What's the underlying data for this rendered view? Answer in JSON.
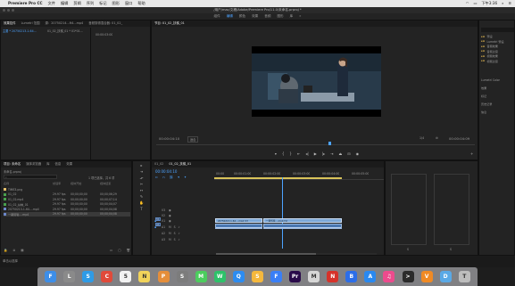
{
  "menubar": {
    "app_name": "Premiere Pro CC",
    "items": [
      "文件",
      "编辑",
      "剪辑",
      "序列",
      "标记",
      "图形",
      "窗口",
      "帮助"
    ],
    "clock": "下午3:36"
  },
  "titlebar": {
    "path": "/用户/mac/文稿/Adobe/Premiere Pro/11.0/未命名.prproj *"
  },
  "workspaces": [
    "组件",
    "编辑",
    "颜色",
    "效果",
    "音频",
    "图形",
    "库",
    "»"
  ],
  "source_panel": {
    "tabs": [
      "效果控件",
      "Lumetri 范围",
      "源：20750214...ft4...mp4",
      "音频剪辑混合器: 01_02_"
    ],
    "clip_label": "主要 * 20750213-1-64...",
    "sequence_label": "01_02_扶梯_01 * 01*01...",
    "timecode": "00:00:03:00"
  },
  "project_panel": {
    "tabs": [
      "项目: 未命名",
      "媒体浏览器",
      "库",
      "信息",
      "效果"
    ],
    "project_file": "未命名.prproj",
    "selection_info": "1 项已选择，共 6 项",
    "columns": [
      "名称",
      "帧速率",
      "媒体开始",
      "媒体结束"
    ],
    "items": [
      {
        "name": "TIME3.png",
        "fps": "",
        "start": "",
        "end": "",
        "color": "#e4c06a"
      },
      {
        "name": "01_02",
        "fps": "29.97 fps",
        "start": "00;00;00;00",
        "end": "00;00;06;29",
        "color": "#48a14d"
      },
      {
        "name": "01_02.mp4",
        "fps": "29.97 fps",
        "start": "00;00;00;00",
        "end": "00;00;07;14",
        "color": "#48a14d"
      },
      {
        "name": "01_02_扶梯_01",
        "fps": "29.97 fps",
        "start": "00;00;00;00",
        "end": "00;00;04;07",
        "color": "#48a14d"
      },
      {
        "name": "20750213-1-64....mp4",
        "fps": "29.97 fps",
        "start": "00;00;00;00",
        "end": "00;00;04;08",
        "color": "#6b86c8"
      },
      {
        "name": "一期剪辑....mp4",
        "fps": "29.97 fps",
        "start": "00;00;00;00",
        "end": "00;00;04;08",
        "color": "#6b86c8"
      }
    ]
  },
  "program_monitor": {
    "tab": "节目: 01_02_扶梯_01",
    "timecode": "00:00:04:10",
    "zoom": "适合",
    "resolution": "1/4",
    "duration": "00:00:04:09"
  },
  "timeline": {
    "tabs": [
      "01_02",
      "01_02_扶梯_01"
    ],
    "timecode": "00:00:04:10",
    "ruler": [
      "00:00",
      "00:00:01:00",
      "00:00:02:00",
      "00:00:03:00",
      "00:00:04:00",
      "00:00:05:00"
    ],
    "video_tracks": [
      "V3",
      "V2",
      "V1"
    ],
    "audio_tracks": [
      "A1",
      "A2",
      "A3"
    ],
    "clip_v1_a": "20750213-1-64....mp4 [V]",
    "clip_v1_b": "一期剪辑....mp4 [V]",
    "progress_fraction": 0.62
  },
  "effects_panel": {
    "folders": [
      "预设",
      "Lumetri 预设",
      "音频效果",
      "音频过渡",
      "视频效果",
      "视频过渡"
    ],
    "options": [
      "Lumetri Color",
      "效果",
      "标记",
      "历史记录",
      "信息"
    ]
  },
  "status_text": "单击以选择",
  "dock_apps": [
    {
      "name": "finder",
      "label": "F",
      "color": "#3d8ee8"
    },
    {
      "name": "launchpad",
      "label": "L",
      "color": "#8a8a8a"
    },
    {
      "name": "safari",
      "label": "S",
      "color": "#2f9be6"
    },
    {
      "name": "chrome",
      "label": "C",
      "color": "#e04a3a"
    },
    {
      "name": "calendar",
      "label": "5",
      "color": "#f2f2f2"
    },
    {
      "name": "notes",
      "label": "N",
      "color": "#f1d35a"
    },
    {
      "name": "photos",
      "label": "P",
      "color": "#e58e3a"
    },
    {
      "name": "system-prefs",
      "label": "S",
      "color": "#7c7c7c"
    },
    {
      "name": "messages",
      "label": "M",
      "color": "#4ccd5e"
    },
    {
      "name": "wechat",
      "label": "W",
      "color": "#2ec26a"
    },
    {
      "name": "qq",
      "label": "Q",
      "color": "#2d8cf0"
    },
    {
      "name": "sketch",
      "label": "S",
      "color": "#f5b83d"
    },
    {
      "name": "feishu",
      "label": "F",
      "color": "#3a7ff6"
    },
    {
      "name": "premiere",
      "label": "Pr",
      "color": "#2a0a4a"
    },
    {
      "name": "mail",
      "label": "M",
      "color": "#d6d6d6"
    },
    {
      "name": "netease-music",
      "label": "N",
      "color": "#d6322a"
    },
    {
      "name": "baidu-netdisk",
      "label": "B",
      "color": "#2c6ee8"
    },
    {
      "name": "app-store",
      "label": "A",
      "color": "#2a89f0"
    },
    {
      "name": "itunes",
      "label": "♫",
      "color": "#ec4b8d"
    },
    {
      "name": "terminal",
      "label": ">",
      "color": "#2b2b2b"
    },
    {
      "name": "vlc",
      "label": "V",
      "color": "#f08a24"
    },
    {
      "name": "folder",
      "label": "D",
      "color": "#5aa9e6"
    },
    {
      "name": "trash",
      "label": "T",
      "color": "#bdbdbd"
    }
  ]
}
